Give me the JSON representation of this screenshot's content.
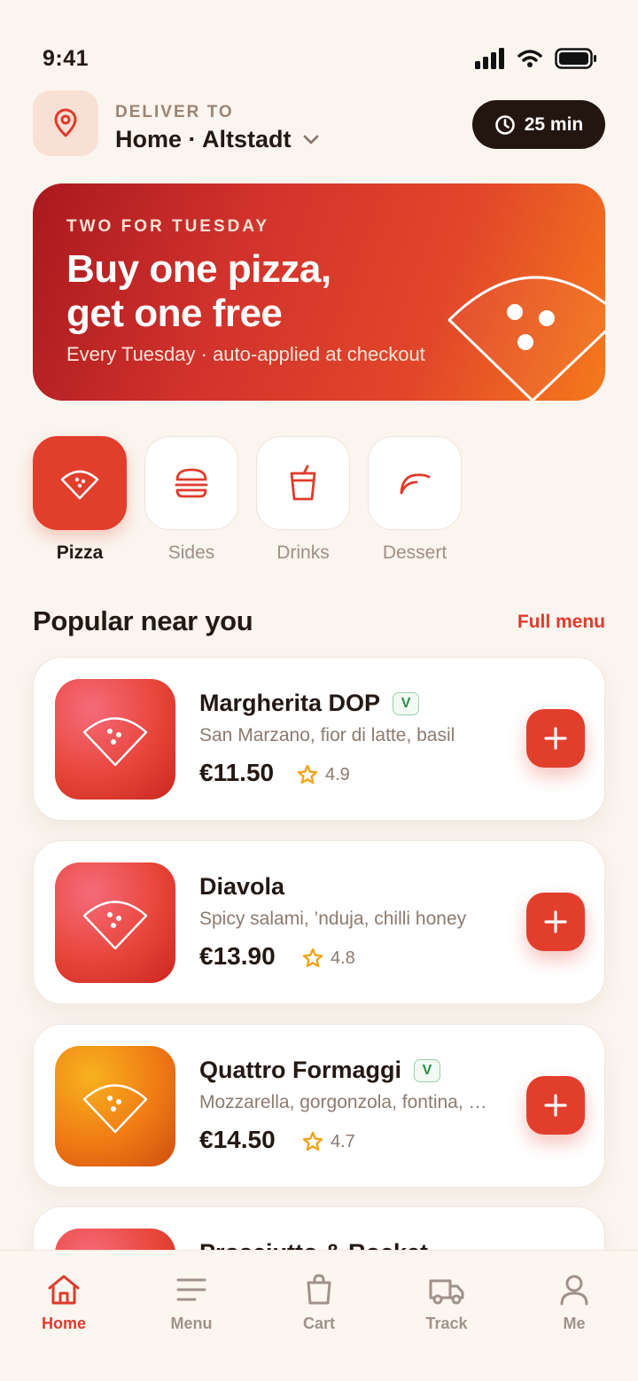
{
  "status_bar": {
    "time": "9:41"
  },
  "header": {
    "deliver_label": "DELIVER TO",
    "address": "Home · Altstadt",
    "eta": "25 min"
  },
  "promo": {
    "eyebrow": "TWO FOR TUESDAY",
    "title_line1": "Buy one pizza,",
    "title_line2": "get one free",
    "subtitle": "Every Tuesday · auto-applied at checkout"
  },
  "categories": [
    {
      "label": "Pizza",
      "icon": "pizza-slice-icon",
      "active": true
    },
    {
      "label": "Sides",
      "icon": "burger-icon",
      "active": false
    },
    {
      "label": "Drinks",
      "icon": "cup-icon",
      "active": false
    },
    {
      "label": "Dessert",
      "icon": "gelato-icon",
      "active": false
    }
  ],
  "section": {
    "title": "Popular near you",
    "link": "Full menu"
  },
  "products": [
    {
      "name": "Margherita DOP",
      "veg": "V",
      "description": "San Marzano, fior di latte, basil",
      "price": "€11.50",
      "rating": "4.9",
      "thumb_color": "red"
    },
    {
      "name": "Diavola",
      "veg": "",
      "description": "Spicy salami, ’nduja, chilli honey",
      "price": "€13.90",
      "rating": "4.8",
      "thumb_color": "red"
    },
    {
      "name": "Quattro Formaggi",
      "veg": "V",
      "description": "Mozzarella, gorgonzola, fontina, parmigiano",
      "price": "€14.50",
      "rating": "4.7",
      "thumb_color": "orange"
    },
    {
      "name": "Prosciutto & Rocket",
      "veg": "",
      "description": "",
      "price": "",
      "rating": "",
      "thumb_color": "red"
    }
  ],
  "bottom_nav": [
    {
      "label": "Home",
      "icon": "home-icon",
      "active": true
    },
    {
      "label": "Menu",
      "icon": "menu-icon",
      "active": false
    },
    {
      "label": "Cart",
      "icon": "bag-icon",
      "active": false
    },
    {
      "label": "Track",
      "icon": "truck-icon",
      "active": false
    },
    {
      "label": "Me",
      "icon": "user-icon",
      "active": false
    }
  ],
  "colors": {
    "accent": "#e23e2c",
    "background": "#fbf5ef",
    "dark": "#231611",
    "veg": "#2d8a47",
    "star": "#f2a417"
  }
}
